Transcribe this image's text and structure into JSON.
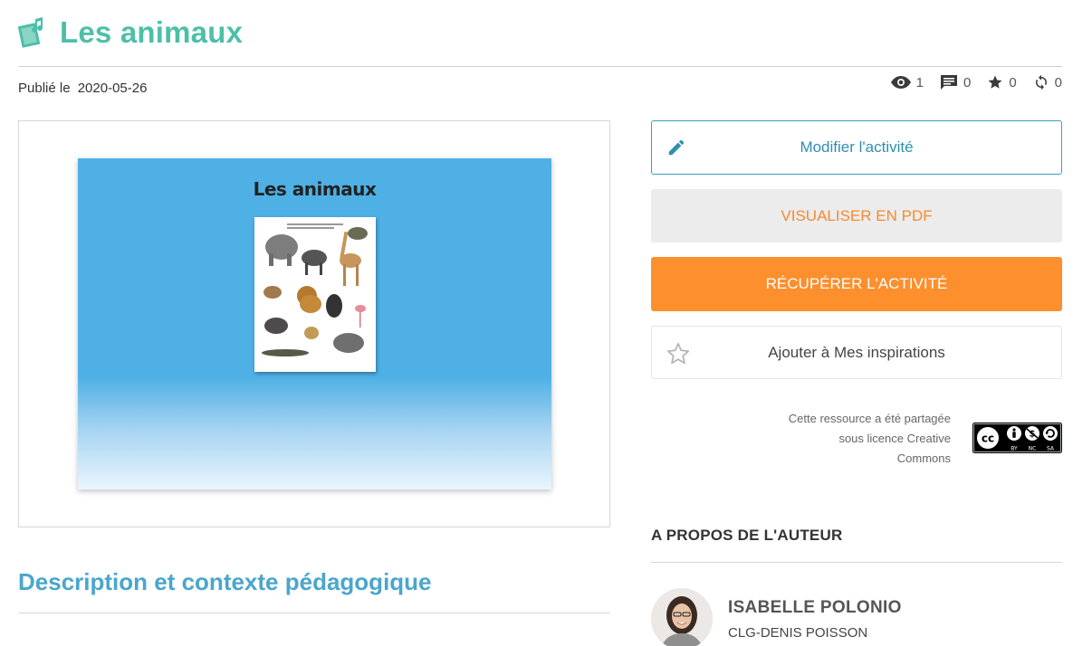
{
  "header": {
    "icon": "music-book-icon",
    "title": "Les animaux",
    "accent_color": "#4dbfa8"
  },
  "meta": {
    "published_label": "Publié le",
    "published_date": "2020-05-26"
  },
  "stats": {
    "views": "1",
    "comments": "0",
    "favorites": "0",
    "shares": "0"
  },
  "preview": {
    "slide_title": "Les animaux"
  },
  "actions": {
    "edit_label": "Modifier l'activité",
    "pdf_label": "VISUALISER EN PDF",
    "get_label": "RÉCUPÉRER L'ACTIVITÉ",
    "inspiration_label": "Ajouter à Mes inspirations",
    "primary_color": "#fd8f2d",
    "edit_color": "#2f8fb1"
  },
  "license": {
    "line1": "Cette ressource a été partagée",
    "line2": "sous licence Creative",
    "line3": "Commons",
    "badge": "cc-by-nc-sa-badge"
  },
  "about": {
    "title": "A PROPOS DE L'AUTEUR",
    "author_name": "ISABELLE POLONIO",
    "author_school": "CLG-DENIS POISSON"
  },
  "description": {
    "title": "Description et contexte pédagogique"
  }
}
